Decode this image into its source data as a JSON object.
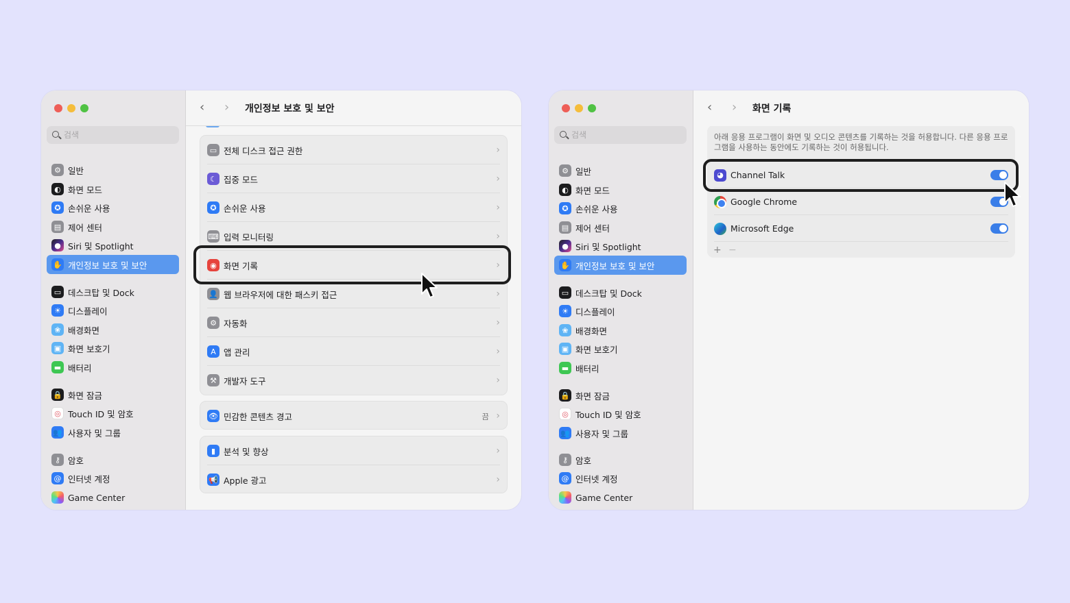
{
  "colors": {
    "background": "#e3e3fd",
    "accent": "#5a98ee",
    "toggle_on": "#3a7ee8",
    "highlight": "#1e1e1e"
  },
  "sidebar": {
    "search_placeholder": "검색",
    "groups": [
      [
        {
          "label": "일반",
          "icon": "gear-icon"
        },
        {
          "label": "화면 모드",
          "icon": "appearance-icon"
        },
        {
          "label": "손쉬운 사용",
          "icon": "accessibility-icon"
        },
        {
          "label": "제어 센터",
          "icon": "control-center-icon"
        },
        {
          "label": "Siri 및 Spotlight",
          "icon": "siri-icon"
        },
        {
          "label": "개인정보 보호 및 보안",
          "icon": "hand-icon",
          "active": true
        }
      ],
      [
        {
          "label": "데스크탑 및 Dock",
          "icon": "dock-icon"
        },
        {
          "label": "디스플레이",
          "icon": "display-icon"
        },
        {
          "label": "배경화면",
          "icon": "wallpaper-icon"
        },
        {
          "label": "화면 보호기",
          "icon": "screensaver-icon"
        },
        {
          "label": "배터리",
          "icon": "battery-icon"
        }
      ],
      [
        {
          "label": "화면 잠금",
          "icon": "lock-icon"
        },
        {
          "label": "Touch ID 및 암호",
          "icon": "fingerprint-icon"
        },
        {
          "label": "사용자 및 그룹",
          "icon": "users-icon"
        }
      ],
      [
        {
          "label": "암호",
          "icon": "key-icon"
        },
        {
          "label": "인터넷 계정",
          "icon": "at-icon"
        },
        {
          "label": "Game Center",
          "icon": "game-center-icon"
        }
      ]
    ]
  },
  "left_window": {
    "title": "개인정보 보호 및 보안",
    "card1": [
      {
        "label": "전체 디스크 접근 권한",
        "icon": "disk-icon"
      },
      {
        "label": "집중 모드",
        "icon": "moon-icon"
      },
      {
        "label": "손쉬운 사용",
        "icon": "accessibility-icon"
      },
      {
        "label": "입력 모니터링",
        "icon": "keyboard-icon"
      },
      {
        "label": "화면 기록",
        "icon": "record-icon"
      },
      {
        "label": "웹 브라우저에 대한 패스키 접근",
        "icon": "passkey-icon"
      },
      {
        "label": "자동화",
        "icon": "automation-icon"
      },
      {
        "label": "앱 관리",
        "icon": "app-store-icon"
      },
      {
        "label": "개발자 도구",
        "icon": "hammer-icon"
      }
    ],
    "card2": {
      "label": "민감한 콘텐츠 경고",
      "value": "끔",
      "icon": "eye-icon"
    },
    "card3": [
      {
        "label": "분석 및 향상",
        "icon": "chart-icon"
      },
      {
        "label": "Apple 광고",
        "icon": "megaphone-icon"
      }
    ]
  },
  "right_window": {
    "title": "화면 기록",
    "description": "아래 응용 프로그램이 화면 및 오디오 콘텐츠를 기록하는 것을 허용합니다. 다른 응용 프로그램을 사용하는 동안에도 기록하는 것이 허용됩니다.",
    "apps": [
      {
        "label": "Channel Talk",
        "icon": "channel-talk-icon",
        "enabled": true
      },
      {
        "label": "Google Chrome",
        "icon": "chrome-icon",
        "enabled": true
      },
      {
        "label": "Microsoft Edge",
        "icon": "edge-icon",
        "enabled": true
      }
    ],
    "add_label": "+",
    "remove_label": "−"
  },
  "nav": {
    "back": "‹",
    "forward": "›",
    "chevron": "›"
  }
}
